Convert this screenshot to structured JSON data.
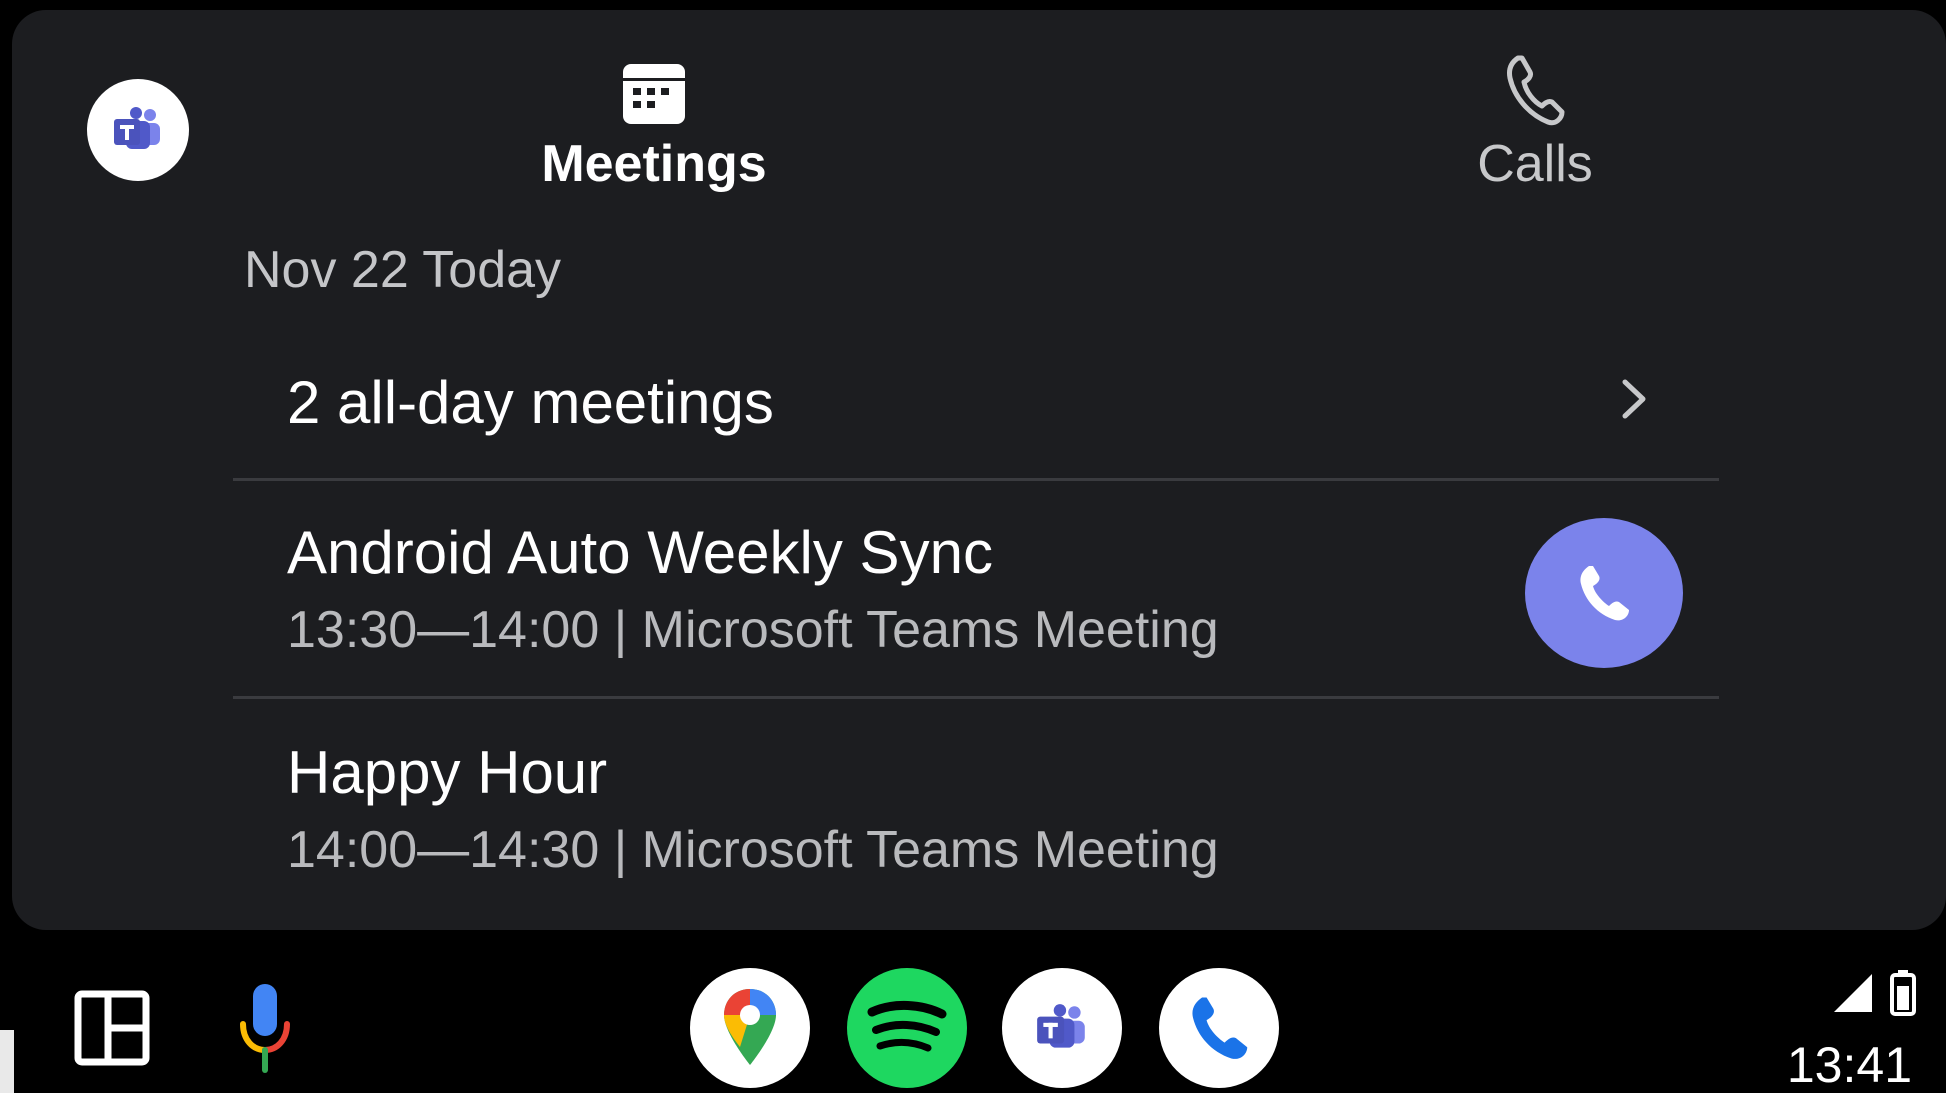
{
  "header": {
    "app_icon": "teams-icon",
    "tabs": [
      {
        "label": "Meetings",
        "icon": "calendar-icon",
        "active": true
      },
      {
        "label": "Calls",
        "icon": "phone-icon",
        "active": false
      }
    ]
  },
  "date_header": "Nov 22 Today",
  "all_day": {
    "label": "2 all-day meetings",
    "icon": "chevron-right-icon"
  },
  "meetings": [
    {
      "title": "Android Auto Weekly Sync",
      "subtitle": "13:30—14:00 | Microsoft Teams Meeting",
      "join_icon": "phone-icon"
    },
    {
      "title": "Happy Hour",
      "subtitle": "14:00—14:30 | Microsoft Teams Meeting"
    }
  ],
  "taskbar": {
    "items": [
      "dashboard-icon",
      "microphone-icon",
      "google-maps-icon",
      "spotify-icon",
      "teams-icon",
      "phone-icon"
    ],
    "clock": "13:41"
  },
  "colors": {
    "accent": "#7b83eb",
    "card_bg": "#1c1d20",
    "background": "#000000",
    "spotify": "#1ed760"
  }
}
